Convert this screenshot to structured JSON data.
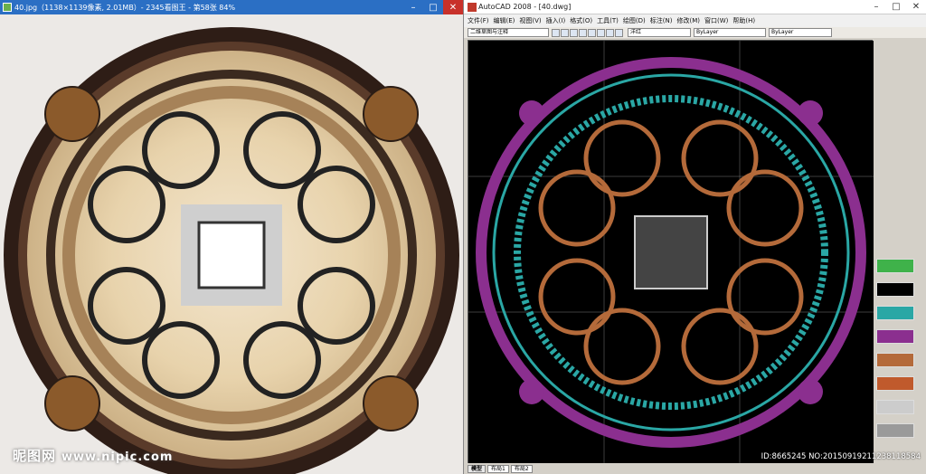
{
  "viewer": {
    "title": "40.jpg（1138×1139像素, 2.01MB）- 2345看图王 - 第58张 84%",
    "watermark_brand": "昵图网",
    "watermark_url": "www.nipic.com",
    "controls": [
      "minimize-icon",
      "maximize-icon",
      "close-icon"
    ]
  },
  "cad": {
    "title": "AutoCAD 2008 - [40.dwg]",
    "menu": [
      "文件(F)",
      "编辑(E)",
      "视图(V)",
      "插入(I)",
      "格式(O)",
      "工具(T)",
      "绘图(D)",
      "标注(N)",
      "修改(M)",
      "窗口(W)",
      "帮助(H)"
    ],
    "workspace": "二维草图与注释",
    "layer": "洋红",
    "linetype": "ByLayer",
    "lineweight": "ByLayer",
    "tabs": [
      "模型",
      "布局1",
      "布局2"
    ],
    "id_text": "ID:8665245 NO:20150919211238118584",
    "swatch_colors": [
      "#3fb24a",
      "#000000",
      "#2aa7a5",
      "#8b2f8f",
      "#b46a3a",
      "#c05a2c",
      "#cccccc",
      "#9a9a9a"
    ]
  },
  "colors": {
    "viewer_title": "#2b6fc4",
    "close": "#c8312a",
    "cad_bg": "#000000"
  }
}
